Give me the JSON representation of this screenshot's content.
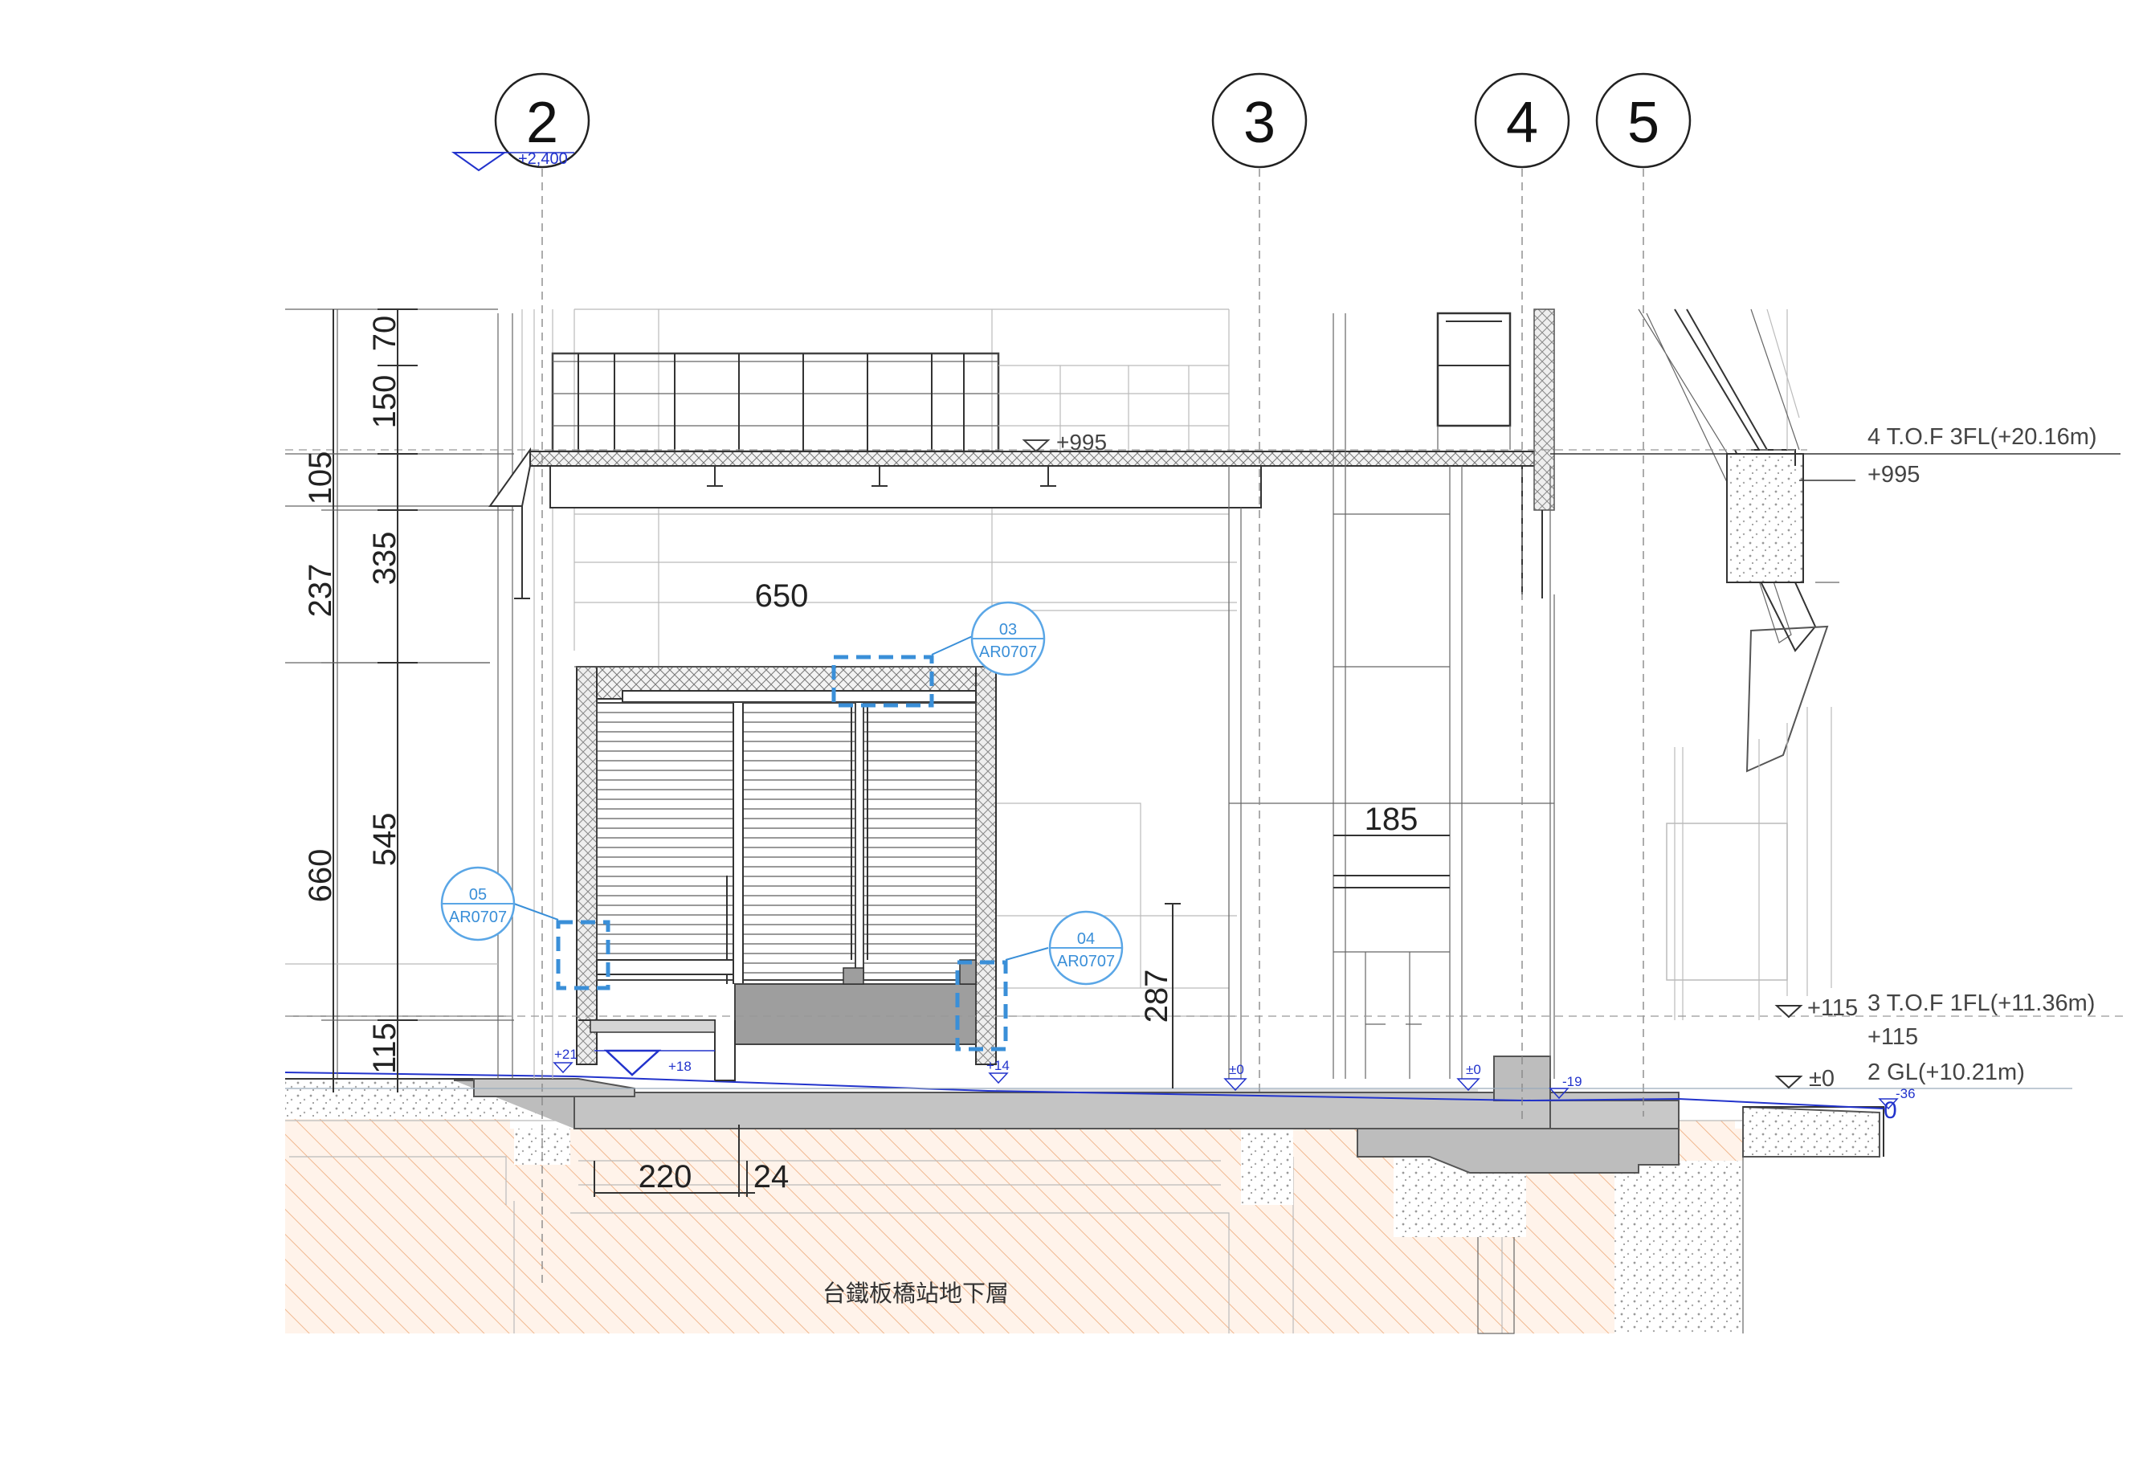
{
  "grid_labels": [
    "2",
    "3",
    "4",
    "5"
  ],
  "level_marks": {
    "top": "+2,400",
    "slab_995": "+995",
    "ground_18": "+18",
    "ground_21": "+21",
    "ground_14": "+14",
    "zero_a": "±0",
    "zero_b": "±0",
    "minus19": "-19",
    "minus36": "-36",
    "zero_right": "0"
  },
  "level_labels": {
    "fl4": "4 T.O.F 3FL(+20.16m)",
    "fl4_sub": "+995",
    "fl3_mark": "+115",
    "fl3": "3 T.O.F 1FL(+11.36m)",
    "fl3_sub": "+115",
    "gl_mark": "±0",
    "gl": "2 GL(+10.21m)"
  },
  "dimensions": {
    "outer": [
      "105",
      "237",
      "660"
    ],
    "inner": [
      "70",
      "150",
      "335",
      "545",
      "115"
    ],
    "width_650": "650",
    "width_185": "185",
    "height_287": "287",
    "width_220": "220",
    "width_24": "24"
  },
  "callouts": [
    {
      "num": "03",
      "ref": "AR0707"
    },
    {
      "num": "05",
      "ref": "AR0707"
    },
    {
      "num": "04",
      "ref": "AR0707"
    }
  ],
  "basement_label": "台鐵板橋站地下層",
  "colors": {
    "callout_blue": "#3a8fd8",
    "level_blue": "#2233cc",
    "ground_hatch": "#f2c4a0",
    "concrete": "#bdbdbd"
  }
}
